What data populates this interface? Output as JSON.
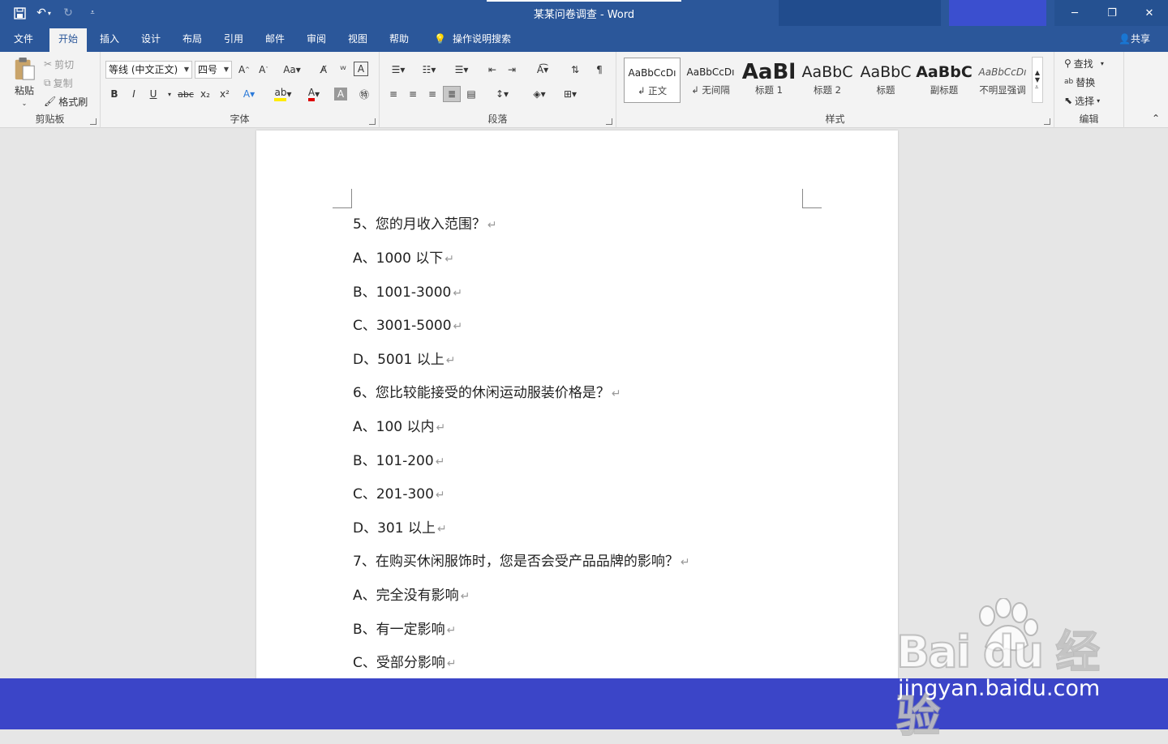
{
  "window": {
    "title": "某某问卷调查  -  Word"
  },
  "tabs": [
    "文件",
    "开始",
    "插入",
    "设计",
    "布局",
    "引用",
    "邮件",
    "审阅",
    "视图",
    "帮助"
  ],
  "active_tab": "开始",
  "tell_me": "操作说明搜索",
  "share": "共享",
  "clipboard": {
    "paste": "粘贴",
    "cut": "剪切",
    "copy": "复制",
    "format_painter": "格式刷",
    "label": "剪贴板"
  },
  "font": {
    "name": "等线 (中文正文)",
    "size": "四号",
    "label": "字体"
  },
  "paragraph": {
    "label": "段落"
  },
  "styles": {
    "label": "样式",
    "items": [
      {
        "preview": "AaBbCcDı",
        "name": "正文"
      },
      {
        "preview": "AaBbCcDı",
        "name": "无间隔"
      },
      {
        "preview": "AaBl",
        "name": "标题 1"
      },
      {
        "preview": "AaBbC",
        "name": "标题 2"
      },
      {
        "preview": "AaBbC",
        "name": "标题"
      },
      {
        "preview": "AaBbC",
        "name": "副标题"
      },
      {
        "preview": "AaBbCcDı",
        "name": "不明显强调"
      }
    ]
  },
  "editing": {
    "find": "查找",
    "replace": "替换",
    "select": "选择",
    "label": "编辑"
  },
  "document": {
    "lines": [
      "5、您的月收入范围？",
      "A、1000 以下",
      "B、1001-3000",
      "C、3001-5000",
      "D、5001 以上",
      "6、您比较能接受的休闲运动服装价格是？",
      "A、100 以内",
      "B、101-200",
      "C、201-300",
      "D、301 以上",
      "7、在购买休闲服饰时，您是否会受产品品牌的影响？",
      "A、完全没有影响",
      "B、有一定影响",
      "C、受部分影响"
    ]
  },
  "watermark": {
    "brand": "Bai  du 经验",
    "site": "jingyan.baidu.com"
  },
  "colors": {
    "title_bar": "#2b579a",
    "footer": "#3b45c8"
  }
}
